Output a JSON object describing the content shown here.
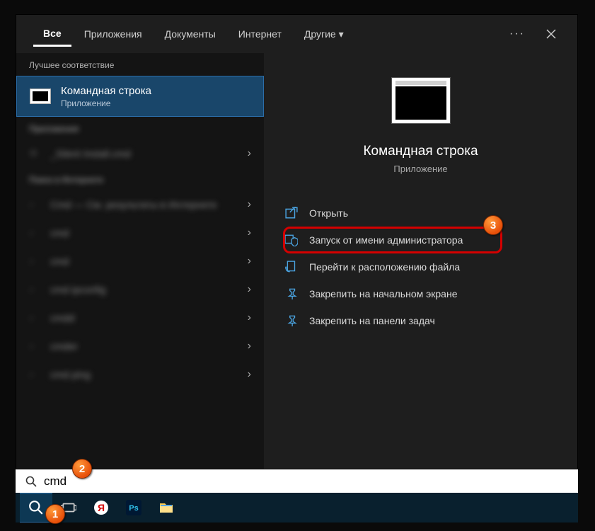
{
  "tabs": {
    "all": "Все",
    "apps": "Приложения",
    "docs": "Документы",
    "internet": "Интернет",
    "other": "Другие"
  },
  "left": {
    "best_header": "Лучшее соответствие",
    "best_title": "Командная строка",
    "best_sub": "Приложение",
    "apps_header": "Приложения",
    "app_item": "_Silent Install.cmd",
    "web_header": "Поиск в Интернете",
    "web_items": [
      "Сmd — См. результаты в Интернете",
      "cmd",
      "cmd",
      "cmd ipconfig",
      "cmdd",
      "cmder",
      "cmd ping"
    ]
  },
  "right": {
    "title": "Командная строка",
    "sub": "Приложение",
    "actions": {
      "open": "Открыть",
      "run_admin": "Запуск от имени администратора",
      "open_loc": "Перейти к расположению файла",
      "pin_start": "Закрепить на начальном экране",
      "pin_taskbar": "Закрепить на панели задач"
    }
  },
  "search": {
    "value": "cmd"
  },
  "badges": {
    "b1": "1",
    "b2": "2",
    "b3": "3"
  }
}
